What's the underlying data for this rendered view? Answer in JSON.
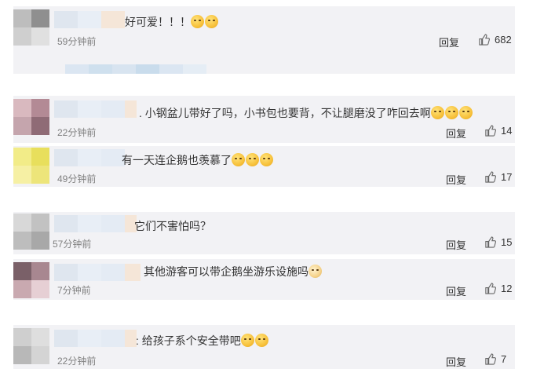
{
  "comments": [
    {
      "text": "好可爱！！！",
      "emoji": [
        "fear-emoji",
        "fear-emoji"
      ],
      "time": "59分钟前",
      "reply": "回复",
      "likes": "682"
    },
    {
      "text": ". 小钢盆儿带好了吗，小书包也要背，不让腿磨没了咋回去啊",
      "emoji": [
        "laugh-emoji",
        "laugh-emoji",
        "laugh-emoji"
      ],
      "time": "22分钟前",
      "reply": "回复",
      "likes": "14"
    },
    {
      "text": "有一天连企鹅也羡慕了",
      "emoji": [
        "sad-emoji",
        "sad-emoji",
        "sad-emoji"
      ],
      "time": "49分钟前",
      "reply": "回复",
      "likes": "17"
    },
    {
      "text": "它们不害怕吗？",
      "emoji": [],
      "time": "57分钟前",
      "reply": "回复",
      "likes": "15"
    },
    {
      "text": "其他游客可以带企鹅坐游乐设施吗",
      "emoji": [
        "cat-emoji"
      ],
      "time": "7分钟前",
      "reply": "回复",
      "likes": "12"
    },
    {
      "text": ": 给孩子系个安全带吧",
      "emoji": [
        "laugh-emoji",
        "laugh-emoji"
      ],
      "time": "22分钟前",
      "reply": "回复",
      "likes": "7"
    }
  ],
  "icons": {
    "like": "thumbs-up-icon"
  },
  "colors": {
    "background": "#ffffff",
    "card": "#f2f2f5",
    "time_text": "#808080"
  }
}
